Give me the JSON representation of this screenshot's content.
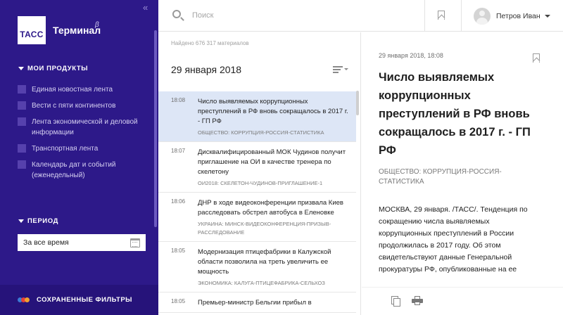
{
  "sidebar": {
    "app_name": "Терминал",
    "app_sup": "β",
    "logo_text": "ТАСС",
    "collapse_glyph": "«",
    "products_title": "МОИ ПРОДУКТЫ",
    "products": [
      {
        "label": "Единая новостная лента"
      },
      {
        "label": "Вести с пяти континентов"
      },
      {
        "label": "Лента экономической и деловой информации"
      },
      {
        "label": "Транспортная лента"
      },
      {
        "label": "Календарь дат и событий (еженедельный)"
      }
    ],
    "period_title": "ПЕРИОД",
    "period_value": "За все время",
    "saved_filters_label": "СОХРАНЕННЫЕ ФИЛЬТРЫ",
    "dot_colors": [
      "#3a7bd5",
      "#e6403a",
      "#f0a030"
    ]
  },
  "topbar": {
    "search_placeholder": "Поиск",
    "user_name": "Петров Иван"
  },
  "list": {
    "found_text": "Найдено 676 317 материалов",
    "date": "29 января 2018",
    "items": [
      {
        "time": "18:08",
        "headline": "Число выявляемых коррупционных преступлений в РФ вновь сокращалось в 2017 г. - ГП РФ",
        "tags": "ОБЩЕСТВО: КОРРУПЦИЯ-РОССИЯ-СТАТИСТИКА"
      },
      {
        "time": "18:07",
        "headline": "Дисквалифицированный МОК Чудинов получит приглашение на ОИ в качестве тренера по скелетону",
        "tags": "ОИ2018: СКЕЛЕТОН-ЧУДИНОВ-ПРИГЛАШЕНИЕ-1"
      },
      {
        "time": "18:06",
        "headline": "ДНР в ходе видеоконференции призвала Киев расследовать обстрел автобуса в Еленовке",
        "tags": "УКРАИНА: МИНСК-ВИДЕОКОНФЕРЕНЦИЯ-ПРИЗЫВ-РАССЛЕДОВАНИЕ"
      },
      {
        "time": "18:05",
        "headline": "Модернизация птицефабрики в Калужской области позволила на треть увеличить ее мощность",
        "tags": "ЭКОНОМИКА: КАЛУГА-ПТИЦЕФАБРИКА-СЕЛЬХОЗ"
      },
      {
        "time": "18:05",
        "headline": "Премьер-министр Бельгии прибыл в",
        "tags": ""
      }
    ]
  },
  "article": {
    "date": "29 января 2018, 18:08",
    "title": "Число выявляемых коррупционных преступлений в РФ вновь сокращалось в 2017 г. - ГП РФ",
    "tags": "ОБЩЕСТВО: КОРРУПЦИЯ-РОССИЯ-СТАТИСТИКА",
    "body": "МОСКВА, 29 января. /ТАСС/. Тенденция по сокращению числа выявляемых коррупционных преступлений в России продолжилась в 2017 году. Об этом свидетельствуют данные Генеральной прокуратуры РФ, опубликованные на ее"
  }
}
